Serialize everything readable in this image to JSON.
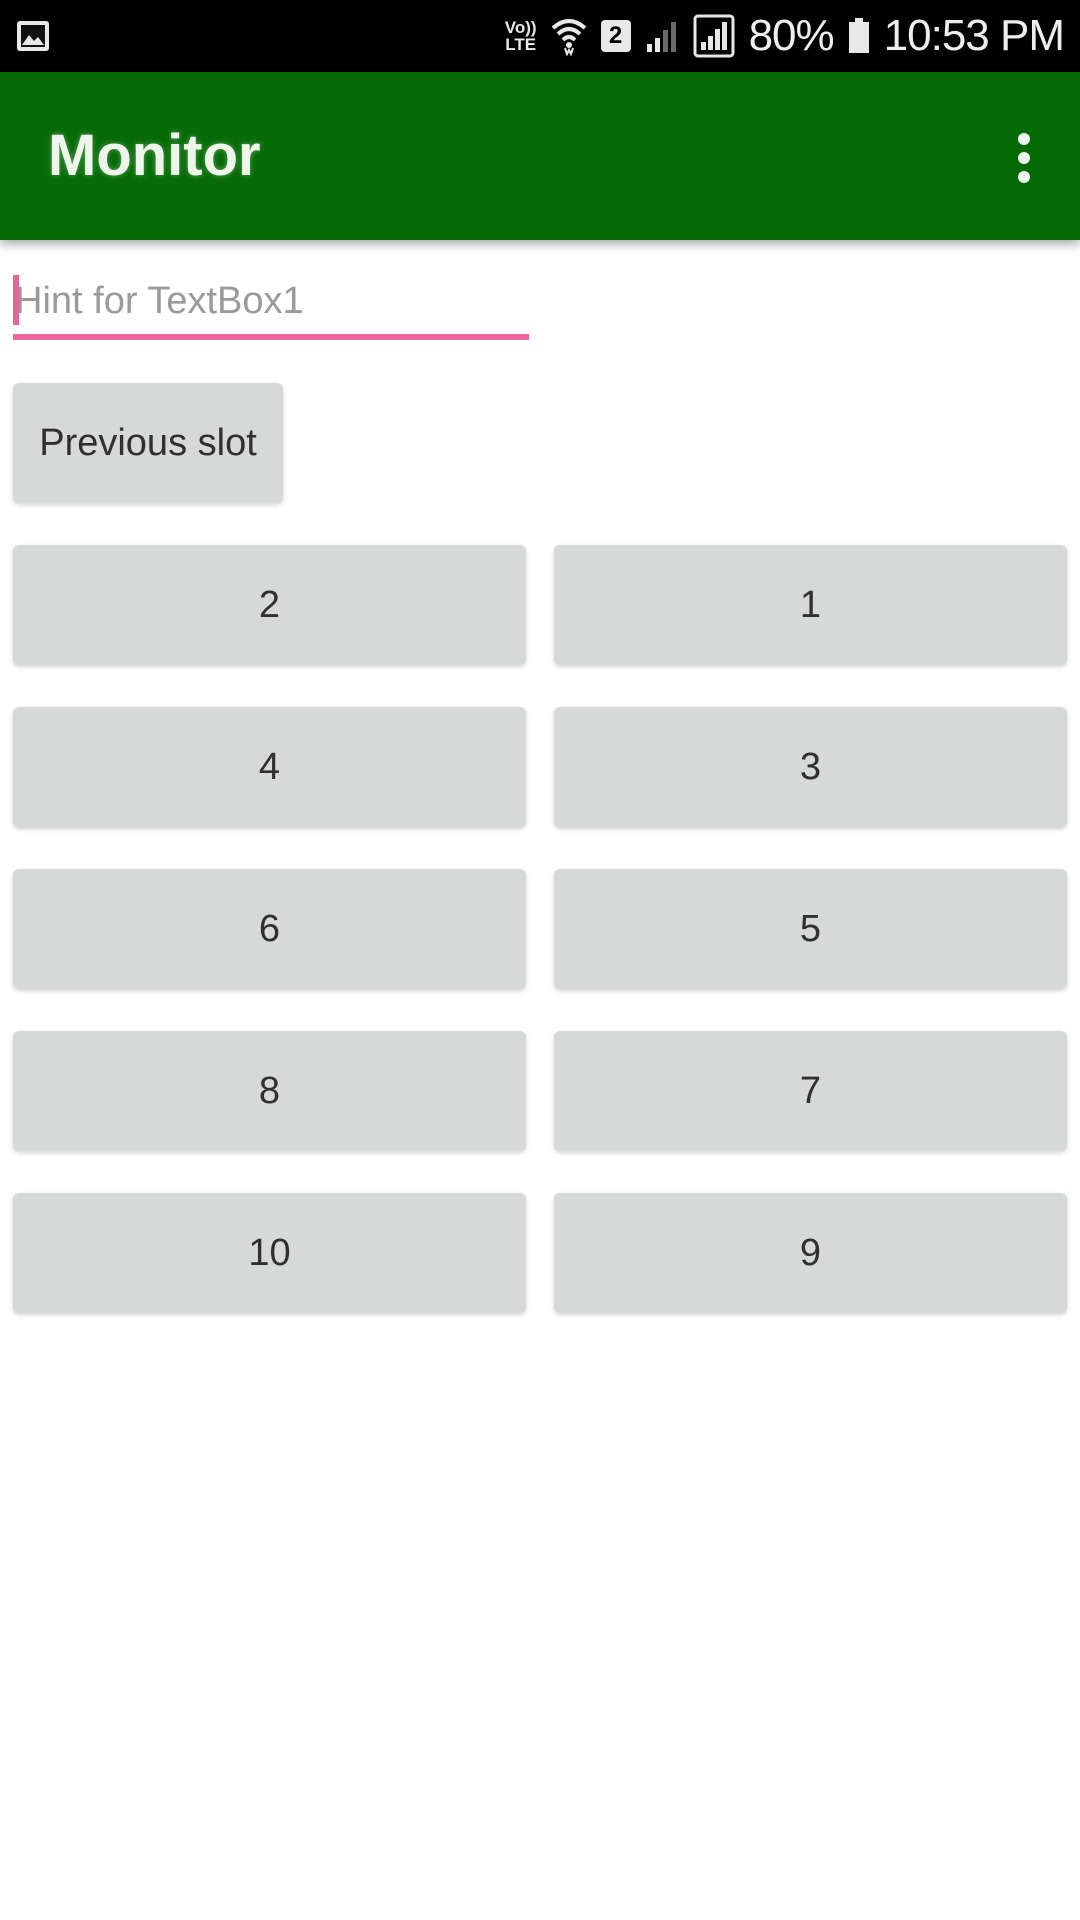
{
  "status_bar": {
    "image_icon": "image-icon",
    "volte_top": "Vo))",
    "volte_bottom": "LTE",
    "sim_slot": "2",
    "battery": "80%",
    "time": "10:53 PM"
  },
  "app_bar": {
    "title": "Monitor",
    "menu_icon": "more-vert-icon",
    "color": "#066b06"
  },
  "textbox": {
    "placeholder": "Hint for TextBox1",
    "value": "",
    "accent_color": "#f0679b"
  },
  "previous_button": {
    "label": "Previous slot"
  },
  "slots": [
    {
      "left": "2",
      "right": "1"
    },
    {
      "left": "4",
      "right": "3"
    },
    {
      "left": "6",
      "right": "5"
    },
    {
      "left": "8",
      "right": "7"
    },
    {
      "left": "10",
      "right": "9"
    }
  ]
}
